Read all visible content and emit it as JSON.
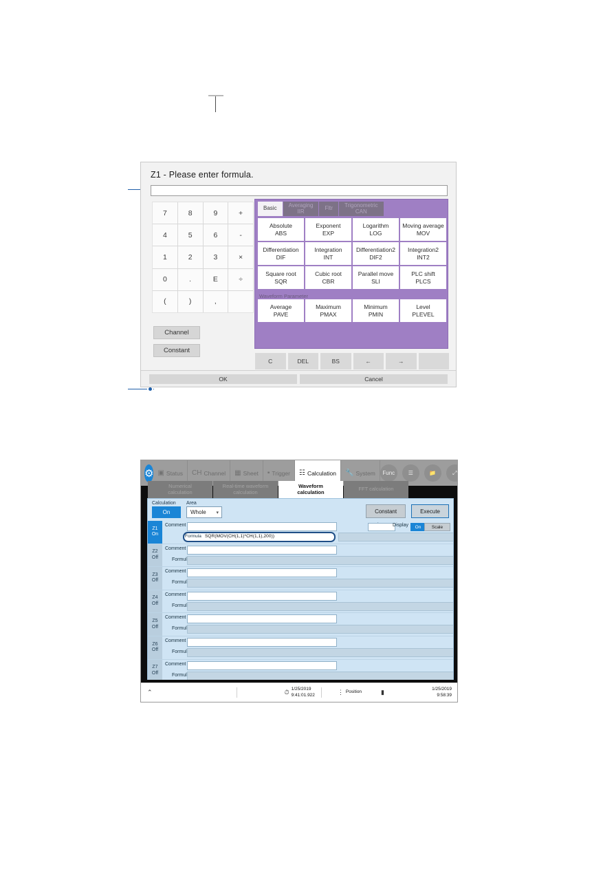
{
  "dialog": {
    "title": "Z1 - Please enter formula.",
    "input_value": "",
    "keypad": [
      "7",
      "8",
      "9",
      "+",
      "4",
      "5",
      "6",
      "-",
      "1",
      "2",
      "3",
      "×",
      "0",
      ".",
      "E",
      "÷",
      "(",
      ")",
      ",",
      ""
    ],
    "side_buttons": [
      {
        "label": "Channel",
        "name": "channel-button"
      },
      {
        "label": "Constant",
        "name": "constant-button"
      }
    ],
    "function_tabs": [
      {
        "label": "Basic",
        "active": true
      },
      {
        "label": "Averaging\nIIR",
        "active": false
      },
      {
        "label": "Fltr",
        "active": false
      },
      {
        "label": "Trigonometric\nCAN",
        "active": false
      }
    ],
    "function_cells": [
      {
        "name": "Absolute",
        "code": "ABS"
      },
      {
        "name": "Exponent",
        "code": "EXP"
      },
      {
        "name": "Logarithm",
        "code": "LOG"
      },
      {
        "name": "Moving average",
        "code": "MOV"
      },
      {
        "name": "Differentiation",
        "code": "DIF"
      },
      {
        "name": "Integration",
        "code": "INT"
      },
      {
        "name": "Differentiation2",
        "code": "DIF2"
      },
      {
        "name": "Integration2",
        "code": "INT2"
      },
      {
        "name": "Square root",
        "code": "SQR"
      },
      {
        "name": "Cubic root",
        "code": "CBR"
      },
      {
        "name": "Parallel move",
        "code": "SLI"
      },
      {
        "name": "PLC shift",
        "code": "PLCS"
      }
    ],
    "waveform_parameter_label": "Waveform Parameter",
    "waveform_parameter_cells": [
      {
        "name": "Average",
        "code": "PAVE"
      },
      {
        "name": "Maximum",
        "code": "PMAX"
      },
      {
        "name": "Minimum",
        "code": "PMIN"
      },
      {
        "name": "Level",
        "code": "PLEVEL"
      }
    ],
    "edit_buttons": [
      "C",
      "DEL",
      "BS",
      "←",
      "→",
      ""
    ],
    "ok_label": "OK",
    "cancel_label": "Cancel"
  },
  "device": {
    "toolbar": {
      "gear_icon": "gear-icon",
      "items": [
        {
          "label": "Status",
          "icon": "status-icon",
          "active": false
        },
        {
          "label": "Channel",
          "icon": "ch-icon",
          "active": false
        },
        {
          "label": "Sheet",
          "icon": "sheet-icon",
          "active": false
        },
        {
          "label": "Trigger",
          "icon": "trigger-icon",
          "active": false
        },
        {
          "label": "Calculation",
          "icon": "calculation-icon",
          "active": true
        },
        {
          "label": "System",
          "icon": "wrench-icon",
          "active": false
        }
      ],
      "func_label": "Func",
      "list_icon": "list-icon",
      "folder_icon": "folder-icon",
      "expand_icon": "expand-arrow-icon"
    },
    "subtabs": [
      {
        "line1": "Numerical",
        "line2": "calculation",
        "active": false
      },
      {
        "line1": "Real-time waveform",
        "line2": "calculation",
        "active": false
      },
      {
        "line1": "Waveform",
        "line2": "calculation",
        "active": true
      },
      {
        "line1": "FFT calculation",
        "line2": "",
        "active": false
      }
    ],
    "controls": {
      "calculation_label": "Calculation",
      "calculation_state": "On",
      "area_label": "Area",
      "area_value": "Whole",
      "constant_label": "Constant",
      "execute_label": "Execute"
    },
    "row_labels": {
      "comment": "Comment",
      "formula": "Formula",
      "units": "Units",
      "display": "Display",
      "display_state": "On",
      "scale": "Scale"
    },
    "rows": [
      {
        "id": "Z1",
        "state": "On",
        "formula": "SQR(MOV(CH(1,1)*CH(1,1),200))",
        "comment": "",
        "units": "",
        "active": true
      },
      {
        "id": "Z2",
        "state": "Off",
        "formula": "",
        "comment": "",
        "units": "",
        "active": false
      },
      {
        "id": "Z3",
        "state": "Off",
        "formula": "",
        "comment": "",
        "units": "",
        "active": false
      },
      {
        "id": "Z4",
        "state": "Off",
        "formula": "",
        "comment": "",
        "units": "",
        "active": false
      },
      {
        "id": "Z5",
        "state": "Off",
        "formula": "",
        "comment": "",
        "units": "",
        "active": false
      },
      {
        "id": "Z6",
        "state": "Off",
        "formula": "",
        "comment": "",
        "units": "",
        "active": false
      },
      {
        "id": "Z7",
        "state": "Off",
        "formula": "",
        "comment": "",
        "units": "",
        "active": false
      }
    ],
    "statusbar": {
      "collapse_icon": "chevron-up-icon",
      "clock_icon": "clock-icon",
      "trigger_date": "1/25/2019",
      "trigger_time": "9:41:01.922",
      "position_label": "Position",
      "position_icon": "position-icon",
      "media_icon": "usb-icon",
      "current_date": "1/25/2019",
      "current_time": "9:58:39"
    }
  },
  "colors": {
    "accent_blue": "#1a85d6",
    "panel_purple": "#9f7fc4",
    "body_blue": "#cfe4f4",
    "lead_blue": "#1f5fa9"
  }
}
